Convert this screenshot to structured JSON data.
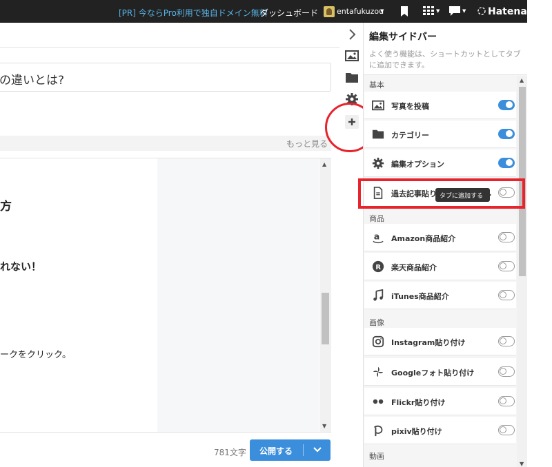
{
  "topbar": {
    "promo": "[PR] 今ならPro利用で独自ドメイン無料",
    "dashboard": "ダッシュボード",
    "username": "entafukuzou",
    "icons": [
      "bookmark-icon",
      "apps-grid-icon",
      "comment-icon"
    ],
    "brand": "Hatena"
  },
  "editor": {
    "title_value": "の違いとは?",
    "more_link": "もっと見る",
    "body_lines": [
      "方",
      "れない！",
      "ークをクリック。"
    ],
    "char_count": "781文字",
    "publish_label": "公開する"
  },
  "tabstrip": {
    "icons": [
      "collapse-chevron-icon",
      "photo-icon",
      "folder-icon",
      "gear-icon",
      "add-tab-icon"
    ]
  },
  "sidebar": {
    "title": "編集サイドバー",
    "description": "よく使う機能は、ショートカットとしてタブに追加できます。",
    "sections": [
      {
        "label": "基本",
        "items": [
          {
            "label": "写真を投稿",
            "icon": "photo-icon",
            "enabled": true
          },
          {
            "label": "カテゴリー",
            "icon": "folder-icon",
            "enabled": true
          },
          {
            "label": "編集オプション",
            "icon": "gear-icon",
            "enabled": true
          },
          {
            "label": "過去記事貼り付け",
            "icon": "document-icon",
            "enabled": false
          }
        ]
      },
      {
        "label": "商品",
        "items": [
          {
            "label": "Amazon商品紹介",
            "icon": "amazon-icon",
            "enabled": false
          },
          {
            "label": "楽天商品紹介",
            "icon": "rakuten-icon",
            "enabled": false
          },
          {
            "label": "iTunes商品紹介",
            "icon": "music-note-icon",
            "enabled": false
          }
        ]
      },
      {
        "label": "画像",
        "items": [
          {
            "label": "Instagram貼り付け",
            "icon": "instagram-icon",
            "enabled": false
          },
          {
            "label": "Googleフォト貼り付け",
            "icon": "google-photos-icon",
            "enabled": false
          },
          {
            "label": "Flickr貼り付け",
            "icon": "flickr-icon",
            "enabled": false
          },
          {
            "label": "pixiv貼り付け",
            "icon": "pixiv-icon",
            "enabled": false
          }
        ]
      },
      {
        "label": "動画",
        "items": []
      }
    ],
    "tooltip": "タブに追加する"
  },
  "colors": {
    "topbar_bg": "#222222",
    "promo_link": "#58b4e8",
    "accent_blue": "#3b8edb",
    "annotation_red": "#e8232c"
  }
}
